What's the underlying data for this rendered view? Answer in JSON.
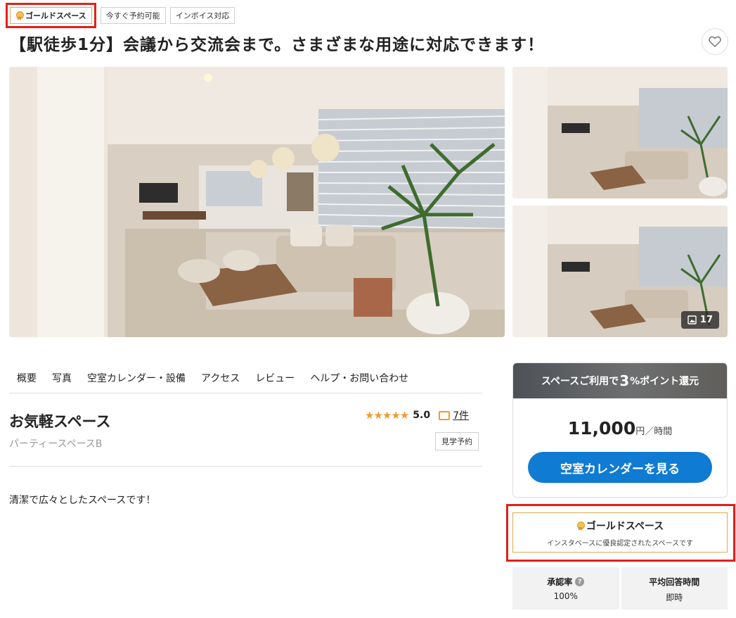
{
  "header": {
    "badges": {
      "gold": "ゴールドスペース",
      "instant": "今すぐ予約可能",
      "invoice": "インボイス対応"
    },
    "title": "【駅徒歩1分】会議から交流会まで。さまざまな用途に対応できます！",
    "favorite_icon": "heart-icon"
  },
  "gallery": {
    "photo_count": "17",
    "photo_count_icon": "image-icon"
  },
  "tabs": [
    "概要",
    "写真",
    "空室カレンダー・設備",
    "アクセス",
    "レビュー",
    "ヘルプ・お問い合わせ"
  ],
  "space": {
    "name": "お気軽スペース",
    "subname": "パーティースペースB",
    "rating": 5,
    "rating_score": "5.0",
    "review_count": "7件",
    "tour_button": "見学予約",
    "description": "清潔で広々としたスペースです！"
  },
  "price_card": {
    "promo_prefix": "スペースご利用で",
    "promo_number": "3",
    "promo_suffix": "%ポイント還元",
    "price": "11,000",
    "price_unit": "円／時間",
    "calendar_button": "空室カレンダーを見る"
  },
  "gold_info": {
    "title": "ゴールドスペース",
    "subtitle": "インスタベースに優良認定されたスペースです"
  },
  "stats": {
    "approval_label": "承認率",
    "approval_value": "100%",
    "response_label": "平均回答時間",
    "response_value": "即時"
  },
  "colors": {
    "accent_blue": "#0f7bd2",
    "star_orange": "#f39a2e",
    "gold_border": "#e3a94e",
    "highlight_red": "#e0201b"
  }
}
